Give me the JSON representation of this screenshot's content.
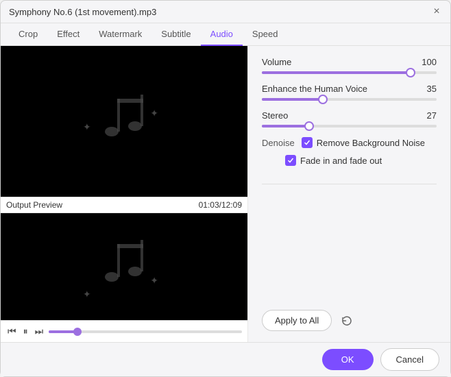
{
  "window": {
    "title": "Symphony No.6 (1st movement).mp3",
    "close_label": "×"
  },
  "tabs": [
    {
      "label": "Crop",
      "active": false
    },
    {
      "label": "Effect",
      "active": false
    },
    {
      "label": "Watermark",
      "active": false
    },
    {
      "label": "Subtitle",
      "active": false
    },
    {
      "label": "Audio",
      "active": true
    },
    {
      "label": "Speed",
      "active": false
    }
  ],
  "sliders": {
    "volume": {
      "label": "Volume",
      "value": 100,
      "percent": 85
    },
    "enhance": {
      "label": "Enhance the Human Voice",
      "value": 35,
      "percent": 35
    },
    "stereo": {
      "label": "Stereo",
      "value": 27,
      "percent": 27
    }
  },
  "denoise": {
    "label": "Denoise",
    "checkbox1_label": "Remove Background Noise",
    "checkbox2_label": "Fade in and fade out"
  },
  "output_preview": {
    "label": "Output Preview",
    "time": "01:03/12:09"
  },
  "playback": {
    "progress_percent": 15
  },
  "actions": {
    "apply_to_all": "Apply to All",
    "ok": "OK",
    "cancel": "Cancel"
  }
}
